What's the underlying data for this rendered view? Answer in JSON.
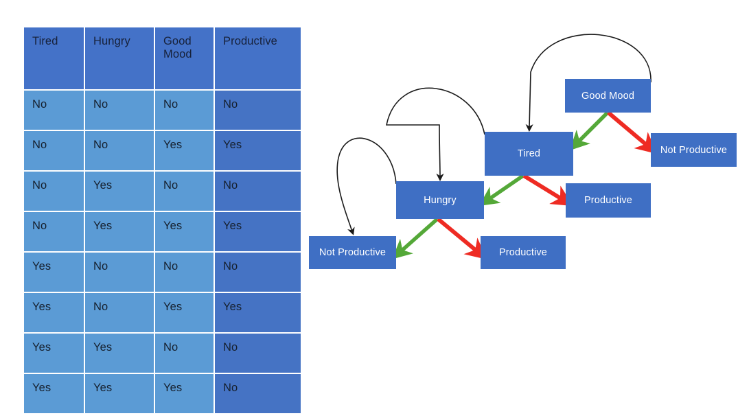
{
  "table": {
    "name": "productivity-truth-table",
    "columns": [
      "Tired",
      "Hungry",
      "Good Mood",
      "Productive"
    ],
    "target_column_index": 3,
    "colors": {
      "header_bg": "#4472C8",
      "cell_bg": "#5B9BD5",
      "target_cell_bg": "#4573C4",
      "text": "#16202e"
    },
    "rows": [
      [
        "No",
        "No",
        "No",
        "No"
      ],
      [
        "No",
        "No",
        "Yes",
        "Yes"
      ],
      [
        "No",
        "Yes",
        "No",
        "No"
      ],
      [
        "No",
        "Yes",
        "Yes",
        "Yes"
      ],
      [
        "Yes",
        "No",
        "No",
        "No"
      ],
      [
        "Yes",
        "No",
        "Yes",
        "Yes"
      ],
      [
        "Yes",
        "Yes",
        "No",
        "No"
      ],
      [
        "Yes",
        "Yes",
        "Yes",
        "No"
      ]
    ]
  },
  "diagram": {
    "name": "decision-tree",
    "colors": {
      "node_bg": "#3F6FC4",
      "node_text": "#ffffff",
      "yes_branch": "#54A838",
      "no_branch": "#EE2B23",
      "loop_arc": "#1a1a1a"
    },
    "nodes": [
      {
        "id": "good-mood",
        "label": "Good Mood",
        "type": "decision"
      },
      {
        "id": "tired",
        "label": "Tired",
        "type": "decision"
      },
      {
        "id": "not-productive-right",
        "label": "Not Productive",
        "type": "leaf"
      },
      {
        "id": "hungry",
        "label": "Hungry",
        "type": "decision"
      },
      {
        "id": "productive-right",
        "label": "Productive",
        "type": "leaf"
      },
      {
        "id": "not-productive-left",
        "label": "Not Productive",
        "type": "leaf"
      },
      {
        "id": "productive-bottom",
        "label": "Productive",
        "type": "leaf"
      }
    ],
    "edges": [
      {
        "from": "good-mood",
        "to": "tired",
        "branch": "yes",
        "color": "#54A838"
      },
      {
        "from": "good-mood",
        "to": "not-productive-right",
        "branch": "no",
        "color": "#EE2B23"
      },
      {
        "from": "tired",
        "to": "hungry",
        "branch": "yes",
        "color": "#54A838"
      },
      {
        "from": "tired",
        "to": "productive-right",
        "branch": "no",
        "color": "#EE2B23"
      },
      {
        "from": "hungry",
        "to": "not-productive-left",
        "branch": "yes",
        "color": "#54A838"
      },
      {
        "from": "hungry",
        "to": "productive-bottom",
        "branch": "no",
        "color": "#EE2B23"
      }
    ],
    "loop_arcs": [
      {
        "from": "good-mood",
        "to": "tired"
      },
      {
        "from": "tired",
        "to": "hungry"
      },
      {
        "from": "hungry",
        "to": "not-productive-left"
      }
    ]
  }
}
